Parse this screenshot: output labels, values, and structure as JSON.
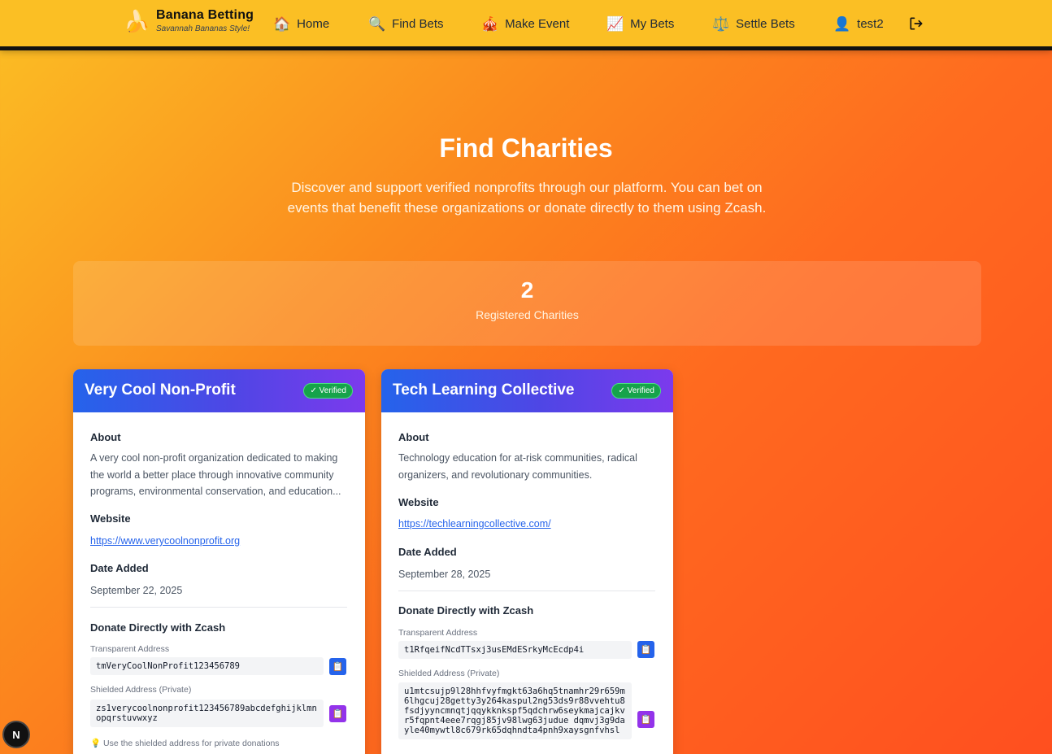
{
  "nav": {
    "brand_icon": "🍌",
    "brand_title": "Banana Betting",
    "brand_subtitle": "Savannah Bananas Style!",
    "items": [
      {
        "icon": "🏠",
        "label": "Home"
      },
      {
        "icon": "🔍",
        "label": "Find Bets"
      },
      {
        "icon": "🎪",
        "label": "Make Event"
      },
      {
        "icon": "📈",
        "label": "My Bets"
      },
      {
        "icon": "⚖️",
        "label": "Settle Bets"
      },
      {
        "icon": "👤",
        "label": "test2"
      }
    ],
    "logout_icon": "logout-icon"
  },
  "hero": {
    "title": "Find Charities",
    "description": "Discover and support verified nonprofits through our platform. You can bet on events that benefit these organizations or donate directly to them using Zcash."
  },
  "stats": {
    "count": "2",
    "label": "Registered Charities"
  },
  "charities": [
    {
      "name": "Very Cool Non-Profit",
      "badge": "✓ Verified",
      "about_label": "About",
      "about": "A very cool non-profit organization dedicated to making the world a better place through innovative community programs, environmental conservation, and education...",
      "website_label": "Website",
      "website": "https://www.verycoolnonprofit.org",
      "date_label": "Date Added",
      "date": "September 22, 2025",
      "donate_label": "Donate Directly with Zcash",
      "transparent_label": "Transparent Address",
      "transparent": "tmVeryCoolNonProfit123456789",
      "shielded_label": "Shielded Address (Private)",
      "shielded": "zs1verycoolnonprofit123456789abcdefghijklmnopqrstuvwxyz",
      "tip": "💡 Use the shielded address for private donations"
    },
    {
      "name": "Tech Learning Collective",
      "badge": "✓ Verified",
      "about_label": "About",
      "about": "Technology education for at-risk communities, radical organizers, and revolutionary communities.",
      "website_label": "Website",
      "website": "https://techlearningcollective.com/",
      "date_label": "Date Added",
      "date": "September 28, 2025",
      "donate_label": "Donate Directly with Zcash",
      "transparent_label": "Transparent Address",
      "transparent": "t1RfqeifNcdTTsxj3usEMdESrkyMcEcdp4i",
      "shielded_label": "Shielded Address (Private)",
      "shielded": "u1mtcsujp9l28hhfvyfmgkt63a6hq5tnamhr29r659m6lhgcuj28getty3y264kaspul2ng53ds9r88vvehtu8fsdjyyncmnqtjqqykknkspf5qdchrw6seykmajcajkvr5fqpnt4eee7rqgj85jv98lwg63judue dqmvj3g9dayle40mywtl8c679rk65dqhndta4pnh9xaysgnfvhsl"
    }
  ],
  "badge_n": "N",
  "colors": {
    "nav_bg": "#fbbf24",
    "accent_blue": "#2563eb",
    "accent_purple": "#7c3aed",
    "verified_green": "#16a34a"
  }
}
